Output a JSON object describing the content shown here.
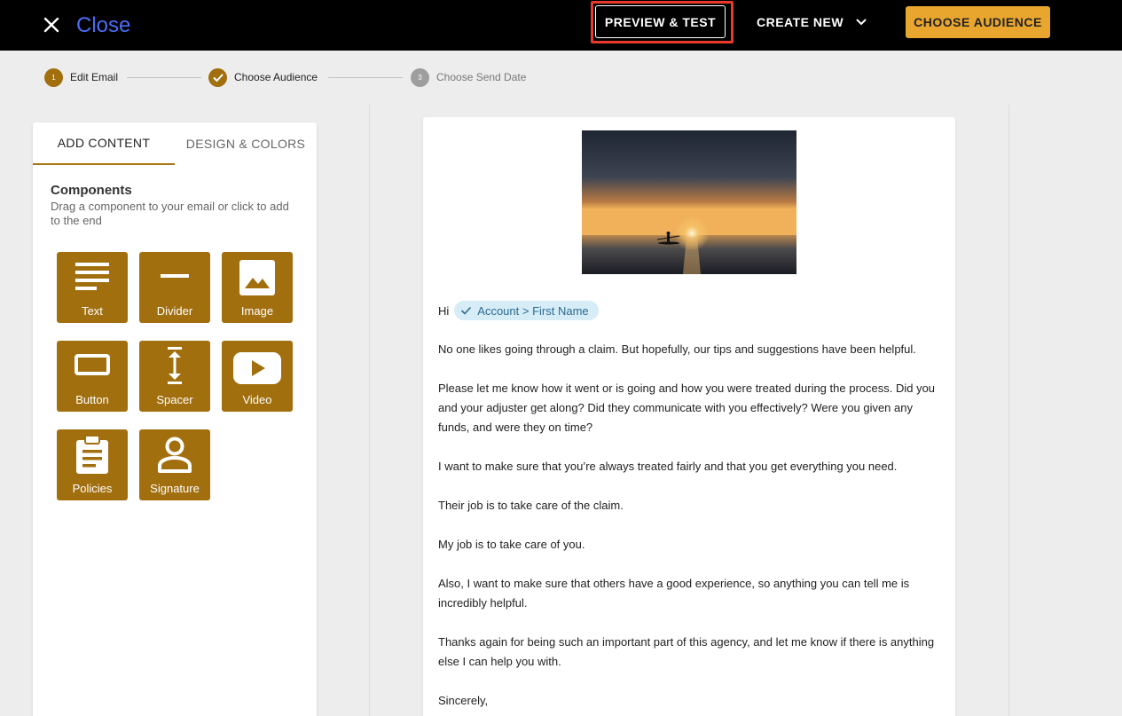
{
  "topbar": {
    "close_label": "Close",
    "preview_label": "PREVIEW & TEST",
    "create_label": "CREATE NEW",
    "audience_label": "CHOOSE AUDIENCE",
    "accent_color": "#e9a62e",
    "highlight_color": "#e8392a"
  },
  "stepper": {
    "steps": [
      {
        "number": "1",
        "label": "Edit Email",
        "state": "current"
      },
      {
        "number": "",
        "label": "Choose Audience",
        "state": "completed"
      },
      {
        "number": "3",
        "label": "Choose Send Date",
        "state": "pending"
      }
    ]
  },
  "panel": {
    "tabs": [
      "ADD CONTENT",
      "DESIGN & COLORS"
    ],
    "components_title": "Components",
    "components_subtitle": "Drag a component to your email or click to add to the end",
    "tile_color": "#a26f0f",
    "components": [
      {
        "label": "Text",
        "icon": "text-lines-icon"
      },
      {
        "label": "Divider",
        "icon": "divider-icon"
      },
      {
        "label": "Image",
        "icon": "image-icon"
      },
      {
        "label": "Button",
        "icon": "button-icon"
      },
      {
        "label": "Spacer",
        "icon": "spacer-icon"
      },
      {
        "label": "Video",
        "icon": "video-icon"
      },
      {
        "label": "Policies",
        "icon": "clipboard-icon"
      },
      {
        "label": "Signature",
        "icon": "person-icon"
      }
    ]
  },
  "email": {
    "greeting": "Hi",
    "merge_tag": "Account > First Name",
    "paragraphs": [
      "No one likes going through a claim. But hopefully, our tips and suggestions have been helpful.",
      "Please let me know how it went or is going and how you were treated during the process. Did you and your adjuster get along? Did they communicate with you effectively? Were you given any funds, and were they on time?",
      "I want to make sure that you’re always treated fairly and that you get everything you need.",
      "Their job is to take care of the claim.",
      "My job is to take care of you.",
      "Also, I want to make sure that others have a good experience, so anything you can tell me is incredibly helpful.",
      "Thanks again for being such an important part of this agency, and let me know if there is anything else I can help you with.",
      "Sincerely,"
    ]
  }
}
